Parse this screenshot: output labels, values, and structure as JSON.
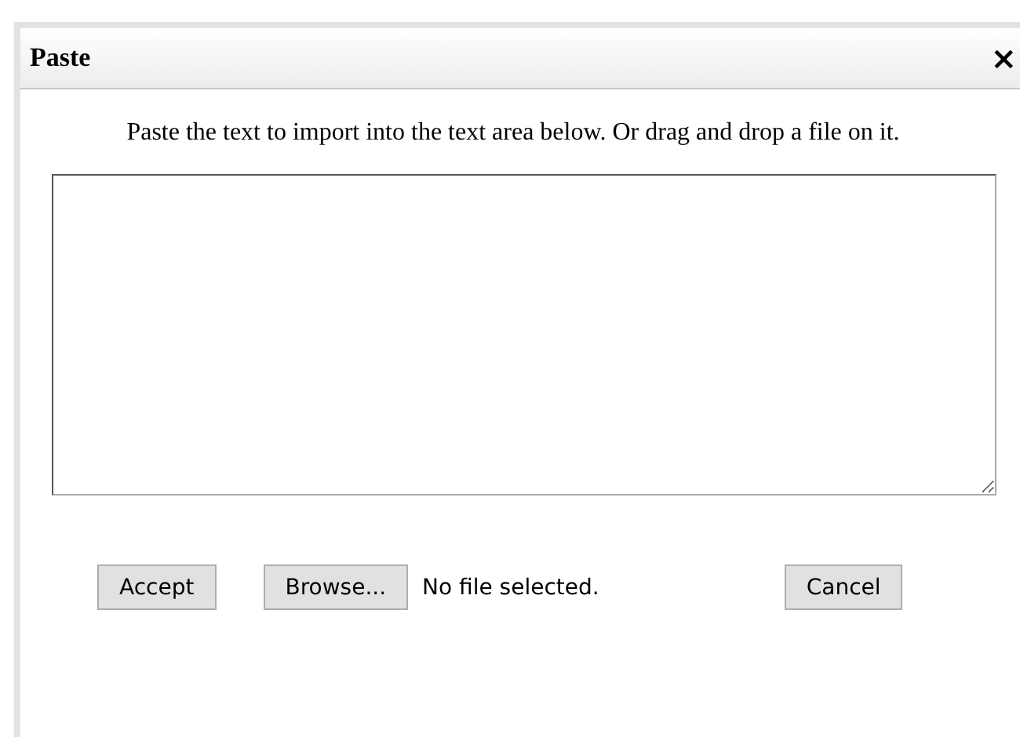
{
  "dialog": {
    "title": "Paste",
    "close": "×",
    "instructions": "Paste the text to import into the text area below. Or drag and drop a file on it.",
    "buttons": [
      {
        "kind": "button",
        "label": "Accept"
      },
      {
        "kind": "file",
        "label": "Browse...",
        "status": "No file selected."
      },
      {
        "kind": "button",
        "label": "Cancel"
      }
    ]
  }
}
